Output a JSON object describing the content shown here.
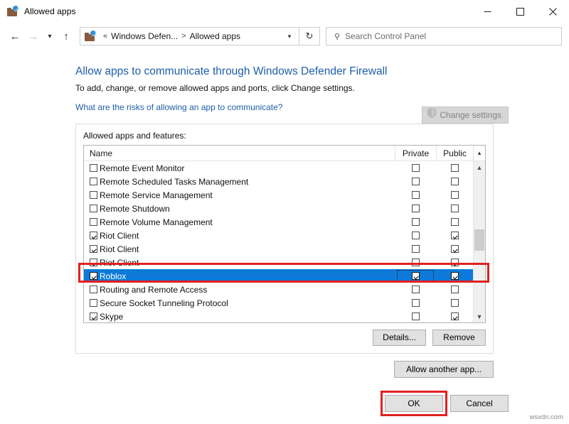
{
  "window": {
    "title": "Allowed apps",
    "icon": "windows-defender-firewall-icon",
    "minimize_label": "Minimize",
    "maximize_label": "Maximize",
    "close_label": "Close"
  },
  "navbar": {
    "back_label": "Back",
    "forward_label": "Forward",
    "recent_label": "Recent locations",
    "up_label": "Up",
    "breadcrumb": {
      "overflow": "«",
      "items": [
        "Windows Defen...",
        "Allowed apps"
      ],
      "separator": ">"
    },
    "refresh_label": "Refresh",
    "search": {
      "placeholder": "Search Control Panel",
      "value": ""
    }
  },
  "page": {
    "title": "Allow apps to communicate through Windows Defender Firewall",
    "subtitle": "To add, change, or remove allowed apps and ports, click Change settings.",
    "risk_link": "What are the risks of allowing an app to communicate?",
    "change_settings_label": "Change settings",
    "change_settings_disabled": true
  },
  "group": {
    "label": "Allowed apps and features:",
    "columns": [
      "Name",
      "Private",
      "Public"
    ],
    "rows": [
      {
        "name": "Remote Event Monitor",
        "enabled": false,
        "private": false,
        "public": false,
        "selected": false
      },
      {
        "name": "Remote Scheduled Tasks Management",
        "enabled": false,
        "private": false,
        "public": false,
        "selected": false
      },
      {
        "name": "Remote Service Management",
        "enabled": false,
        "private": false,
        "public": false,
        "selected": false
      },
      {
        "name": "Remote Shutdown",
        "enabled": false,
        "private": false,
        "public": false,
        "selected": false
      },
      {
        "name": "Remote Volume Management",
        "enabled": false,
        "private": false,
        "public": false,
        "selected": false
      },
      {
        "name": "Riot Client",
        "enabled": true,
        "private": false,
        "public": true,
        "selected": false
      },
      {
        "name": "Riot Client",
        "enabled": true,
        "private": false,
        "public": true,
        "selected": false
      },
      {
        "name": "Riot Client",
        "enabled": true,
        "private": false,
        "public": true,
        "selected": false
      },
      {
        "name": "Roblox",
        "enabled": true,
        "private": true,
        "public": true,
        "selected": true
      },
      {
        "name": "Routing and Remote Access",
        "enabled": false,
        "private": false,
        "public": false,
        "selected": false
      },
      {
        "name": "Secure Socket Tunneling Protocol",
        "enabled": false,
        "private": false,
        "public": false,
        "selected": false
      },
      {
        "name": "Skype",
        "enabled": true,
        "private": false,
        "public": true,
        "selected": false
      }
    ],
    "details_label": "Details...",
    "remove_label": "Remove",
    "allow_another_label": "Allow another app..."
  },
  "footer": {
    "ok_label": "OK",
    "cancel_label": "Cancel"
  },
  "annotations": {
    "highlight_color": "#e02020",
    "selection_color": "#0d7ada"
  },
  "watermark": "wsxdn.com"
}
